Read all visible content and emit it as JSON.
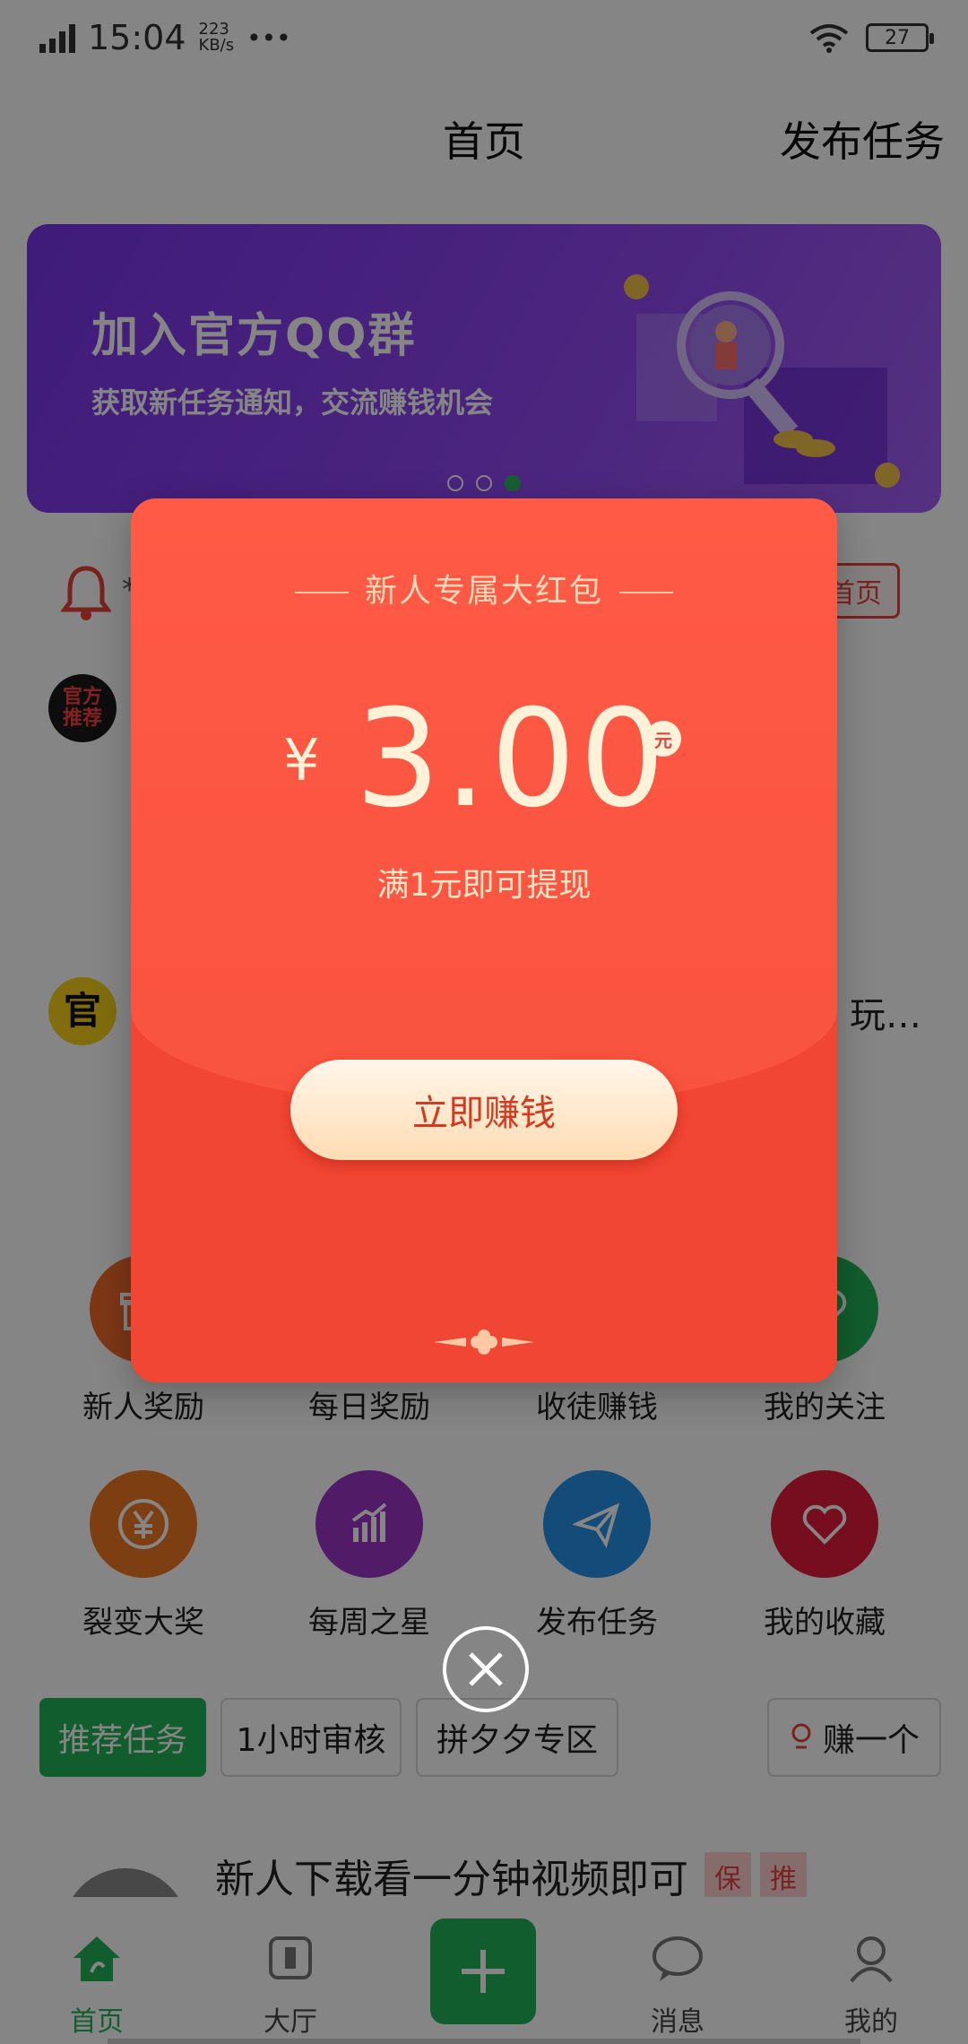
{
  "status_bar": {
    "network": "G",
    "time": "15:04",
    "speed_value": "223",
    "speed_unit": "KB/s",
    "more": "•••",
    "battery": "27"
  },
  "header": {
    "title": "首页",
    "publish_label": "发布任务"
  },
  "banner": {
    "title": "加入官方QQ群",
    "subtitle": "获取新任务通知，交流赚钱机会",
    "dots": 3,
    "active_dot": 3
  },
  "notice": {
    "text": "*",
    "back_home": "首页"
  },
  "feed": [
    {
      "avatar": "官方推荐",
      "trail": ""
    },
    {
      "avatar": "官",
      "trail": "玩…"
    }
  ],
  "grid": [
    {
      "label": "新人奖励",
      "icon": "gift-icon",
      "color": "#f06a2a"
    },
    {
      "label": "每日奖励",
      "icon": "calendar-icon",
      "color": "#f7b32b"
    },
    {
      "label": "收徒赚钱",
      "icon": "users-icon",
      "color": "#2a9df4"
    },
    {
      "label": "我的关注",
      "icon": "heart-icon",
      "color": "#22b357"
    },
    {
      "label": "裂变大奖",
      "icon": "yen-icon",
      "color": "#f07a23"
    },
    {
      "label": "每周之星",
      "icon": "chart-icon",
      "color": "#9b35c8"
    },
    {
      "label": "发布任务",
      "icon": "send-icon",
      "color": "#2591e8"
    },
    {
      "label": "我的收藏",
      "icon": "heart-icon",
      "color": "#e51c3c"
    }
  ],
  "tabs": [
    {
      "label": "推荐任务",
      "active": true
    },
    {
      "label": "1小时审核",
      "active": false
    },
    {
      "label": "拼夕夕专区",
      "active": false
    },
    {
      "label": "赚一个",
      "active": false
    }
  ],
  "task": {
    "title": "新人下载看一分钟视频即可",
    "tags": [
      "保",
      "推"
    ]
  },
  "bottom_nav": [
    {
      "label": "首页",
      "icon": "home-icon",
      "active": true
    },
    {
      "label": "大厅",
      "icon": "hall-icon",
      "active": false
    },
    {
      "label": "",
      "icon": "plus-icon",
      "active": false
    },
    {
      "label": "消息",
      "icon": "message-icon",
      "active": false
    },
    {
      "label": "我的",
      "icon": "user-icon",
      "active": false
    }
  ],
  "red_packet": {
    "title": "新人专属大红包",
    "currency": "¥",
    "amount": "3.00",
    "unit": "元",
    "note": "满1元即可提现",
    "button": "立即赚钱"
  },
  "colors": {
    "accent_green": "#22b357",
    "packet_red": "#f24634",
    "banner_purple": "#8f46f2"
  }
}
